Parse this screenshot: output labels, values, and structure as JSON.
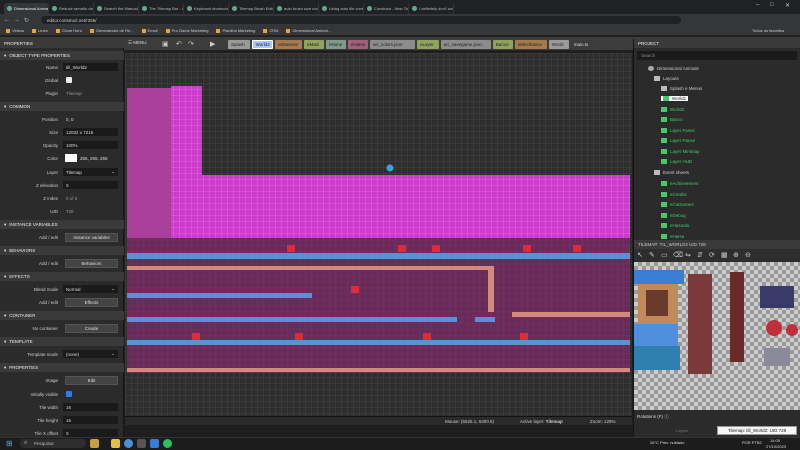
{
  "browser": {
    "tabs": [
      {
        "label": "Dimensional Animals - Constr...",
        "active": true
      },
      {
        "label": "Reducir tamaño de arquivo..."
      },
      {
        "label": "Search the Manual"
      },
      {
        "label": "The Tilemap Bar - Construct..."
      },
      {
        "label": "Keyboard shortcuts - Constr..."
      },
      {
        "label": "Tilemap Brush Editor - Cons..."
      },
      {
        "label": "auto brush size construct 3"
      },
      {
        "label": "Using auto tile construct..."
      },
      {
        "label": "Construct - New Topic"
      },
      {
        "label": "I definitely don't understan..."
      }
    ],
    "url": "editor.construct.net/r356/",
    "bookmarks": [
      {
        "label": "Videos"
      },
      {
        "label": "Lines"
      },
      {
        "label": "Clone Hero"
      },
      {
        "label": "Generatodor de Re..."
      },
      {
        "label": "Email"
      },
      {
        "label": "Pro Game Marketing"
      },
      {
        "label": "Planilha Marketing"
      },
      {
        "label": "CRM"
      },
      {
        "label": "Dimensional Animal..."
      }
    ],
    "all_bookmarks": "Todos os favoritos"
  },
  "editor": {
    "menu_label": "MENU",
    "layout_tabs": [
      {
        "label": "Splash",
        "color": "#9a9a9a"
      },
      {
        "label": "World2",
        "color": "#a9c7ff",
        "active": true
      },
      {
        "label": "eDownsie",
        "color": "#a77a4b"
      },
      {
        "label": "eMain",
        "color": "#8fa35a"
      },
      {
        "label": "eNone",
        "color": "#7f9a8a"
      },
      {
        "label": "eHaHa",
        "color": "#a0607a"
      },
      {
        "label": "arr_colors.json",
        "color": "#8c8c8c"
      },
      {
        "label": "eLayer",
        "color": "#8fa35a"
      },
      {
        "label": "arr_savegame.json",
        "color": "#8c8c8c"
      },
      {
        "label": "Banco",
        "color": "#8fa35a"
      },
      {
        "label": "eMechanics",
        "color": "#a77a4b"
      },
      {
        "label": "World",
        "color": "#9a9a9a"
      },
      {
        "label": "main.ts",
        "color": "#3c3c3c"
      }
    ],
    "properties": {
      "panel_title": "PROPERTIES",
      "object_section": "OBJECT TYPE PROPERTIES",
      "name_label": "Name",
      "name_value": "till_World2",
      "global_label": "Global",
      "plugin_label": "Plugin",
      "plugin_value": "Tilemap",
      "common_section": "COMMON",
      "position_label": "Position",
      "position_value": "0, 0",
      "size_label": "Size",
      "size_value": "12032 x 7216",
      "opacity_label": "Opacity",
      "opacity_value": "100%",
      "color_label": "Color",
      "color_value": "255, 255, 255",
      "layer_label": "Layer",
      "layer_value": "Tilemap",
      "zelevation_label": "Z elevation",
      "zelevation_value": "0",
      "zindex_label": "Z index",
      "zindex_value": "0 of 6",
      "uid_label": "UID",
      "uid_value": "728",
      "instvars_section": "INSTANCE VARIABLES",
      "addedit_label": "Add / edit",
      "instvars_button": "Instance variables",
      "behaviors_section": "BEHAVIORS",
      "behaviors_button": "Behaviors",
      "effects_section": "EFFECTS",
      "blend_label": "Blend mode",
      "blend_value": "Normal",
      "effects_button": "Effects",
      "container_section": "CONTAINER",
      "no_container_label": "No container",
      "create_button": "Create",
      "template_section": "TEMPLATE",
      "template_mode_label": "Template mode",
      "template_mode_value": "(none)",
      "properties_section": "PROPERTIES",
      "image_label": "Image",
      "edit_button": "Edit",
      "initially_visible_label": "Initially visible",
      "tile_width_label": "Tile width",
      "tile_width_value": "16",
      "tile_height_label": "Tile height",
      "tile_height_value": "16",
      "tile_x_offset_label": "Tile X offset",
      "tile_x_offset_value": "0"
    },
    "status": {
      "mouse": "Mouse: (5526.1, 6300.5)",
      "active_layer_label": "Active layer:",
      "active_layer": "Tilemap",
      "zoom": "Zoom: 128%"
    },
    "project": {
      "panel_title": "PROJECT",
      "search_placeholder": "Search",
      "root": "Dimensional Animals",
      "layouts_folder": "Layouts",
      "splash_folder": "Splash e Menus",
      "layouts": [
        "World1",
        "World2",
        "Banco",
        "Layer Fases",
        "Layer Pause",
        "Layer Minimap",
        "Layer HUD"
      ],
      "event_folder": "Event sheets",
      "events": [
        "eAchievement",
        "eCredits",
        "eCutscenes",
        "eDebug",
        "eHazards",
        "eHaHa"
      ]
    },
    "tilemap_bar": {
      "title": "TILEMAP: TIL_WORLD2 UID 728",
      "rotations_label": "Rotations (F)",
      "layers_label": "Layers",
      "tooltip": "Tilemap: till_World2: UID 728"
    }
  },
  "taskbar": {
    "search_placeholder": "Pesquisar",
    "weather": "26°C Prev. nublado",
    "lang": "POR PTB2",
    "time": "14:05",
    "date": "27/10/2023"
  }
}
